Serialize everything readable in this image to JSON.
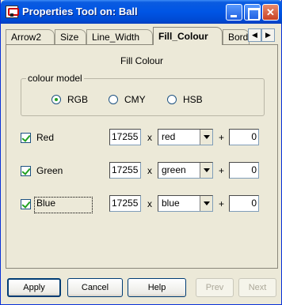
{
  "window": {
    "title": "Properties Tool on: Ball"
  },
  "tabs": [
    {
      "label": "Arrow2",
      "active": false
    },
    {
      "label": "Size",
      "active": false
    },
    {
      "label": "Line_Width",
      "active": false
    },
    {
      "label": "Fill_Colour",
      "active": true
    },
    {
      "label": "Bord",
      "active": false
    }
  ],
  "panel": {
    "title": "Fill Colour",
    "colour_model": {
      "label": "colour model",
      "options": [
        {
          "label": "RGB",
          "selected": true
        },
        {
          "label": "CMY",
          "selected": false
        },
        {
          "label": "HSB",
          "selected": false
        }
      ]
    },
    "channels": [
      {
        "label": "Red",
        "checked": true,
        "amount": "17255",
        "source": "red",
        "offset": "0"
      },
      {
        "label": "Green",
        "checked": true,
        "amount": "17255",
        "source": "green",
        "offset": "0"
      },
      {
        "label": "Blue",
        "checked": true,
        "amount": "17255",
        "source": "blue",
        "offset": "0"
      }
    ],
    "times_symbol": "x",
    "plus_symbol": "+"
  },
  "buttons": {
    "apply": "Apply",
    "cancel": "Cancel",
    "help": "Help",
    "prev": "Prev",
    "next": "Next"
  },
  "colors": {
    "title_bar": "#0055e5",
    "window_bg": "#ece9d8",
    "check_mark": "#21a121"
  }
}
